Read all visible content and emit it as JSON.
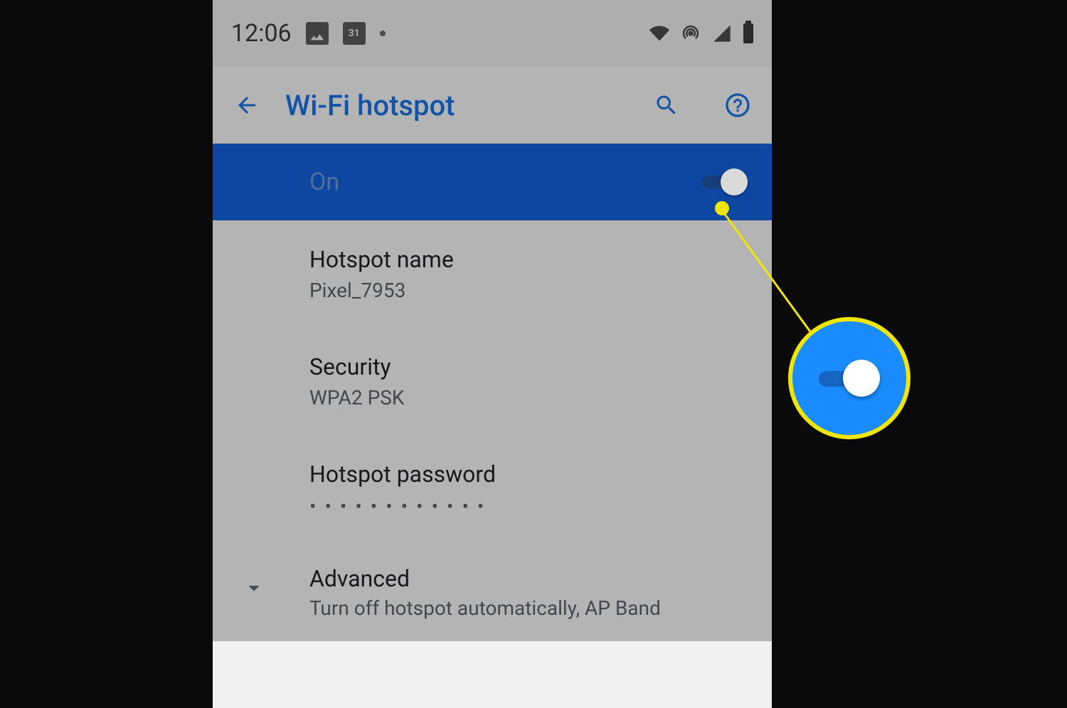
{
  "statusBar": {
    "time": "12:06",
    "calendarDay": "31"
  },
  "actionBar": {
    "title": "Wi-Fi hotspot"
  },
  "hotspotToggle": {
    "label": "On",
    "enabled": true
  },
  "settings": {
    "name": {
      "title": "Hotspot name",
      "value": "Pixel_7953"
    },
    "security": {
      "title": "Security",
      "value": "WPA2 PSK"
    },
    "password": {
      "title": "Hotspot password",
      "value": "••••••••••••"
    },
    "advanced": {
      "title": "Advanced",
      "value": "Turn off hotspot automatically, AP Band"
    }
  }
}
